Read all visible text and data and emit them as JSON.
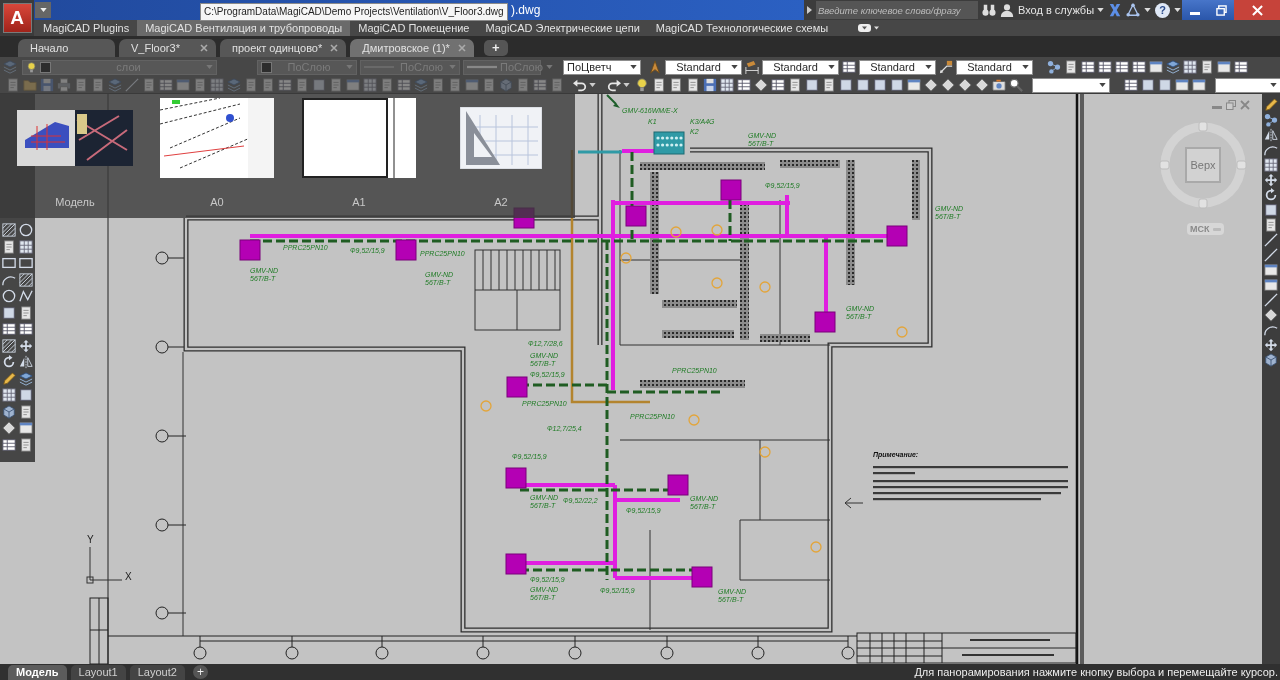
{
  "app_button": "A",
  "title_bar": {
    "title_tail": ").dwg",
    "tooltip": "C:\\ProgramData\\MagiCAD\\Demo Projects\\Ventilation\\V_Floor3.dwg",
    "search": {
      "placeholder": "Введите ключевое слово/фразу"
    },
    "sign_in": "Вход в службы",
    "help": "?"
  },
  "ribbon_tabs": [
    {
      "label": "MagiCAD Plugins",
      "selected": false
    },
    {
      "label": "MagiCAD Вентиляция и трубопроводы",
      "selected": true
    },
    {
      "label": "MagiCAD Помещение",
      "selected": false
    },
    {
      "label": "MagiCAD Электрические цепи",
      "selected": false
    },
    {
      "label": "MagiCAD Технологические схемы",
      "selected": false
    }
  ],
  "file_tabs": [
    {
      "label": "Начало",
      "selected": false,
      "closable": false
    },
    {
      "label": "V_Floor3*",
      "selected": false,
      "closable": true
    },
    {
      "label": "проект одинцово*",
      "selected": false,
      "closable": true
    },
    {
      "label": "Дмитровское (1)*",
      "selected": true,
      "closable": true
    }
  ],
  "new_tab": "+",
  "properties": [
    {
      "kind": "layer",
      "value": "слои",
      "disabled": true
    },
    {
      "kind": "color",
      "value": "ПоСлою",
      "disabled": true
    },
    {
      "kind": "linetype",
      "value": "ПоСлою",
      "disabled": true
    },
    {
      "kind": "lineweight",
      "value": "ПоСлою",
      "disabled": true
    },
    {
      "kind": "plotstyle",
      "value": "ПоЦветч",
      "disabled": false
    }
  ],
  "styles": [
    {
      "kind": "text",
      "value": "Standard"
    },
    {
      "kind": "dimension",
      "value": "Standard"
    },
    {
      "kind": "table",
      "value": "Standard"
    },
    {
      "kind": "multileader",
      "value": "Standard"
    }
  ],
  "layout_previews": [
    {
      "kind": "model",
      "label": "Модель"
    },
    {
      "kind": "sheet",
      "label": "A0"
    },
    {
      "kind": "blank",
      "label": "A1"
    },
    {
      "kind": "new",
      "label": "A2"
    }
  ],
  "plan": {
    "outdoor_unit": {
      "model": "GMV-616WM/E-X",
      "tags": [
        "K1",
        "K3/A4G",
        "K2"
      ]
    },
    "indoor_units": [
      {
        "model": "GMV-ND",
        "size": "56T/B-T"
      },
      {
        "model": "GMV-ND",
        "size": "56T/B-T"
      },
      {
        "model": "GMV-ND",
        "size": "56T/B-T"
      },
      {
        "model": "GMV-ND",
        "size": "56T/B-T"
      },
      {
        "model": "GMV-ND",
        "size": "56T/B-T"
      },
      {
        "model": "GMV-ND",
        "size": "56T/B-T"
      },
      {
        "model": "GMV-ND",
        "size": "56T/B-T"
      },
      {
        "model": "GMV-ND",
        "size": "56T/B-T"
      },
      {
        "model": "GMV-ND",
        "size": "56T/B-T"
      },
      {
        "model": "GMV-ND",
        "size": "56T/B-T"
      }
    ],
    "pipe_labels": [
      "PPRC25PN10",
      "Ф9,52/15,9",
      "PPRC25PN10",
      "Ф12,7/28,6",
      "Ф9,52/15,9",
      "PPRC25PN10",
      "Ф12,7/25,4",
      "Ф9,52/15,9",
      "Ф9,52/22,2",
      "Ф9,52/15,9",
      "Ф9,52/15,9",
      "Ф9,52/15,9",
      "PPRC25PN10",
      "PPRC25PN10",
      "Ф9,52/15,9"
    ],
    "notes_title": "Примечание:",
    "ucs": {
      "x": "X",
      "y": "Y"
    }
  },
  "viewcube": {
    "face": "Верх",
    "ucs": "МСК"
  },
  "layout_tabs": [
    {
      "label": "Модель",
      "selected": true
    },
    {
      "label": "Layout1",
      "selected": false
    },
    {
      "label": "Layout2",
      "selected": false
    }
  ],
  "add_layout": "+",
  "status_text": "Для панорамирования нажмите кнопку выбора и перемещайте курсор."
}
